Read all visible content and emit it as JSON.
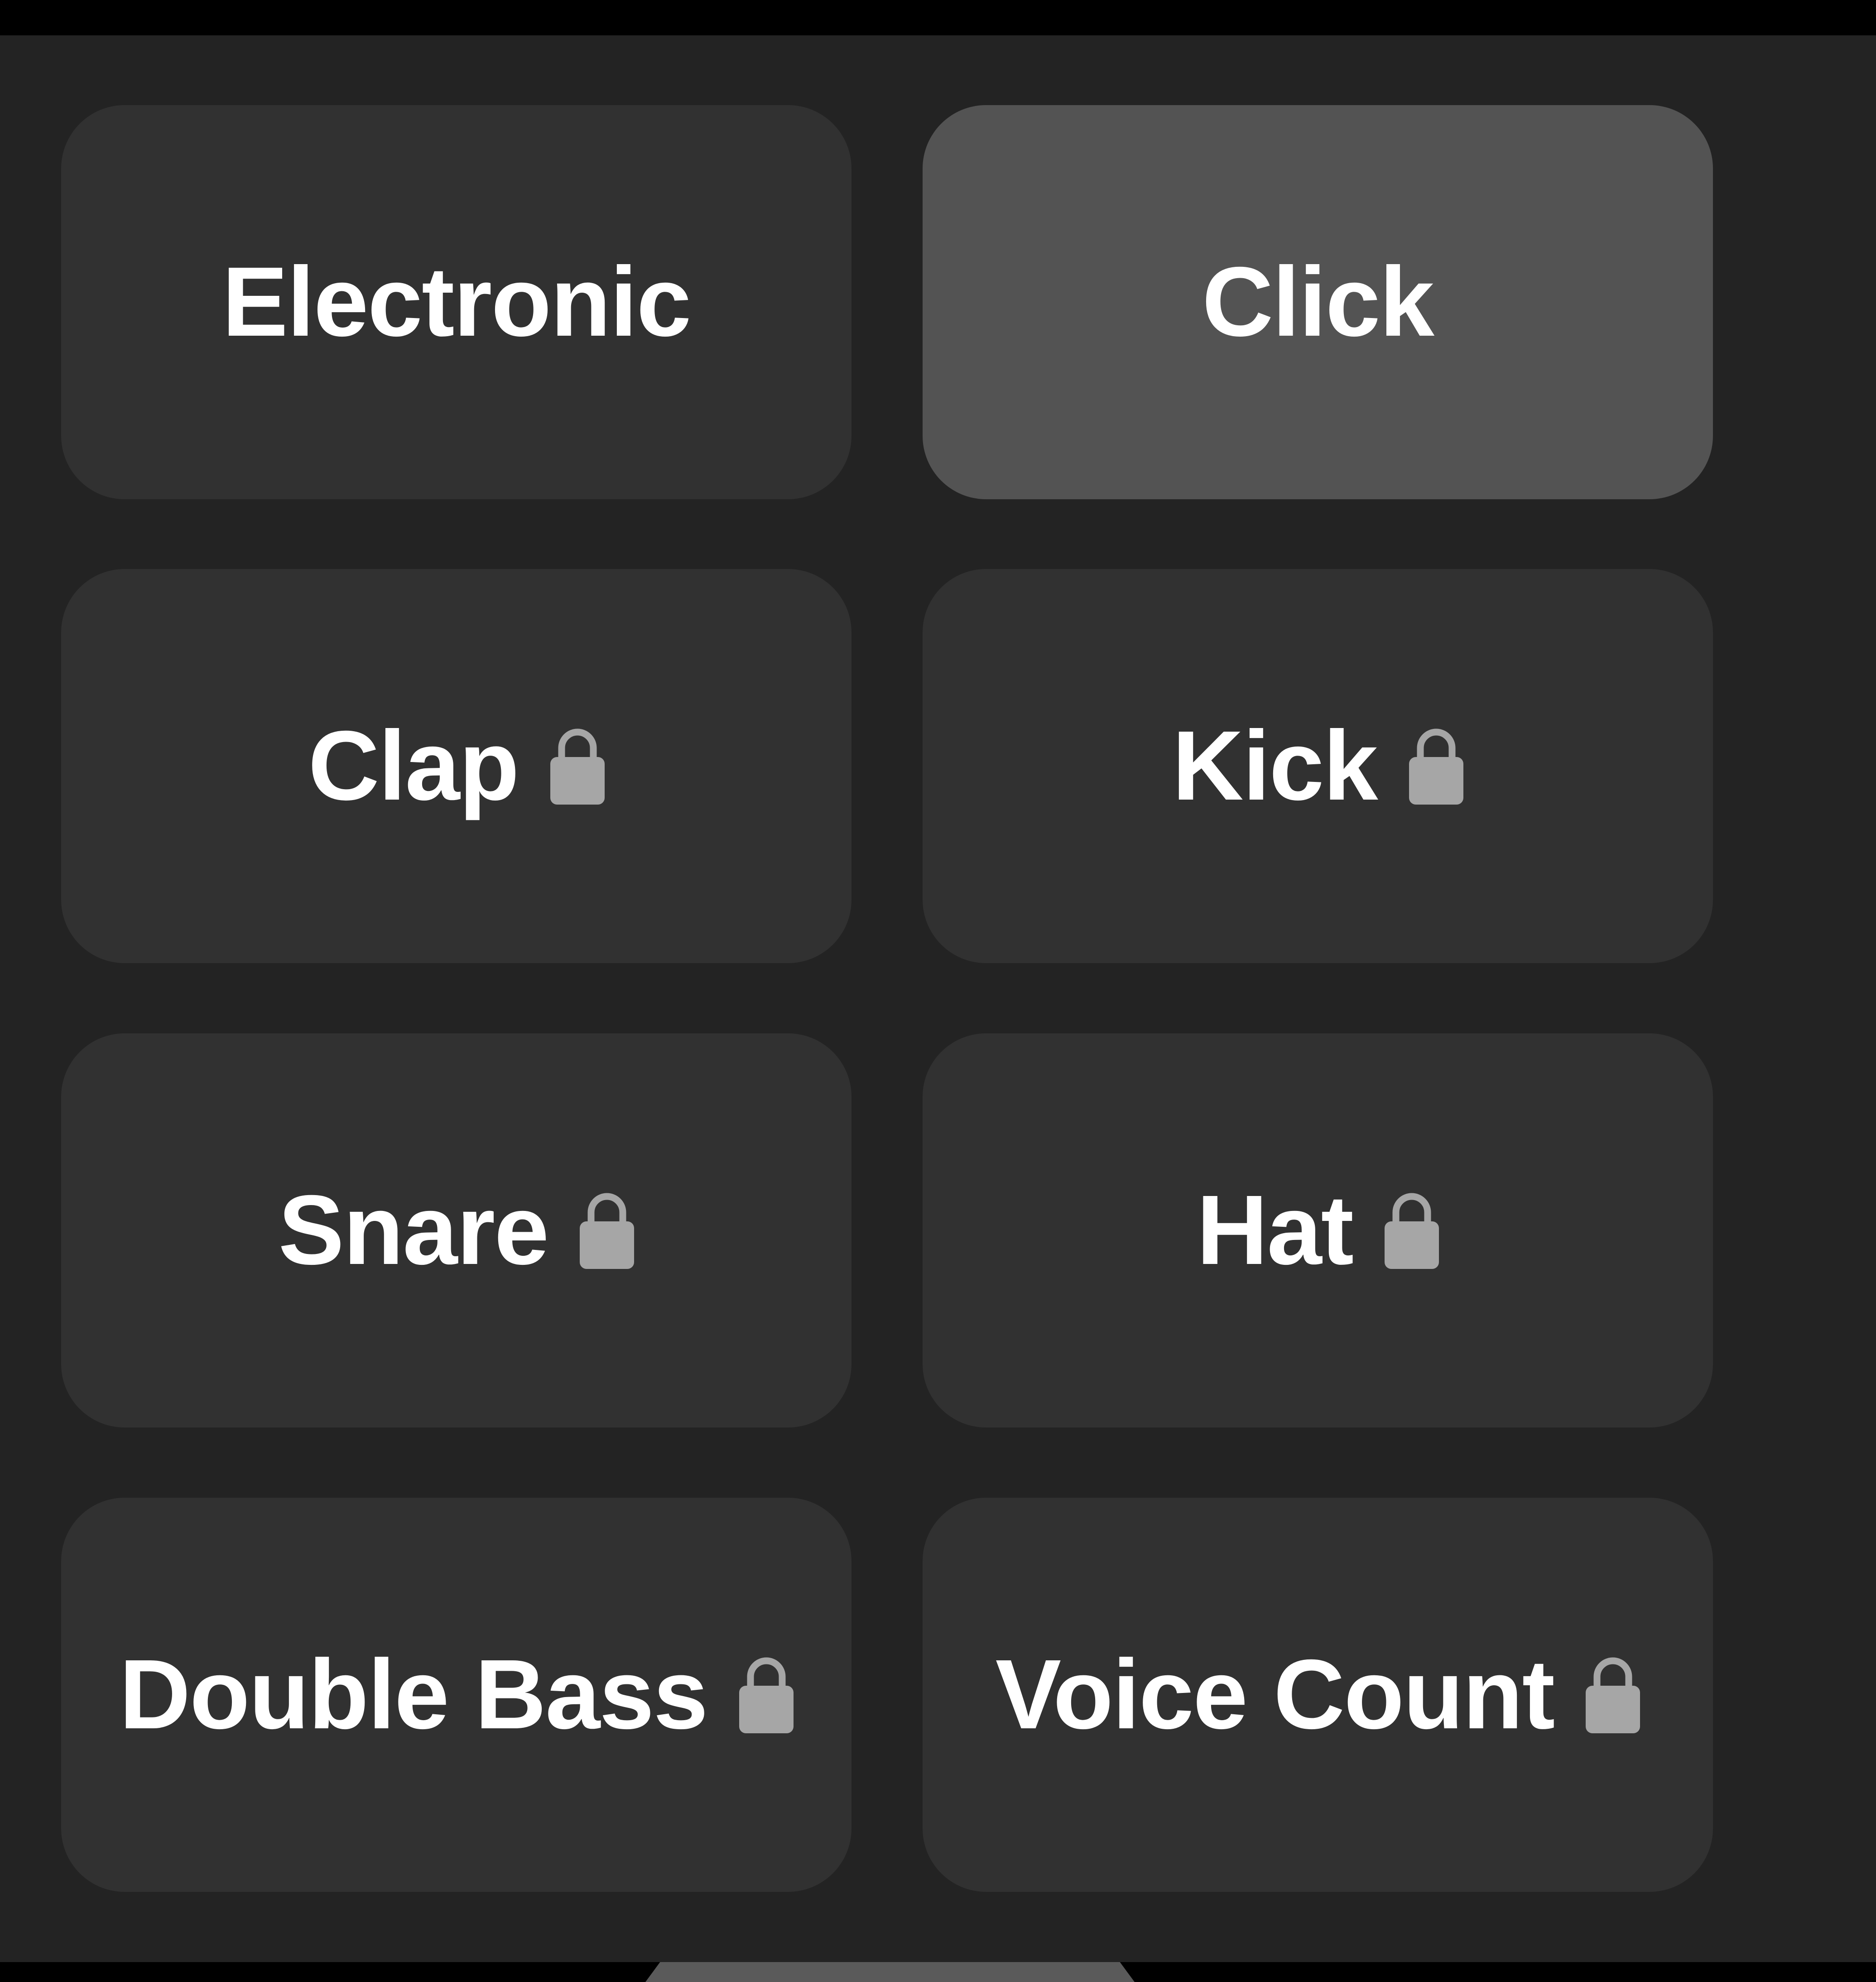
{
  "colors": {
    "panel_background": "#232323",
    "tile_background": "#313131",
    "tile_selected_background": "#535353",
    "label_color": "#ffffff",
    "lock_color": "#a6a6a6"
  },
  "sound_options": [
    {
      "label": "Electronic",
      "selected": false,
      "locked": false,
      "icon": null
    },
    {
      "label": "Click",
      "selected": true,
      "locked": false,
      "icon": null
    },
    {
      "label": "Clap",
      "selected": false,
      "locked": true,
      "icon": "lock-icon"
    },
    {
      "label": "Kick",
      "selected": false,
      "locked": true,
      "icon": "lock-icon"
    },
    {
      "label": "Snare",
      "selected": false,
      "locked": true,
      "icon": "lock-icon"
    },
    {
      "label": "Hat",
      "selected": false,
      "locked": true,
      "icon": "lock-icon"
    },
    {
      "label": "Double Bass",
      "selected": false,
      "locked": true,
      "icon": "lock-icon"
    },
    {
      "label": "Voice Count",
      "selected": false,
      "locked": true,
      "icon": "lock-icon"
    }
  ]
}
